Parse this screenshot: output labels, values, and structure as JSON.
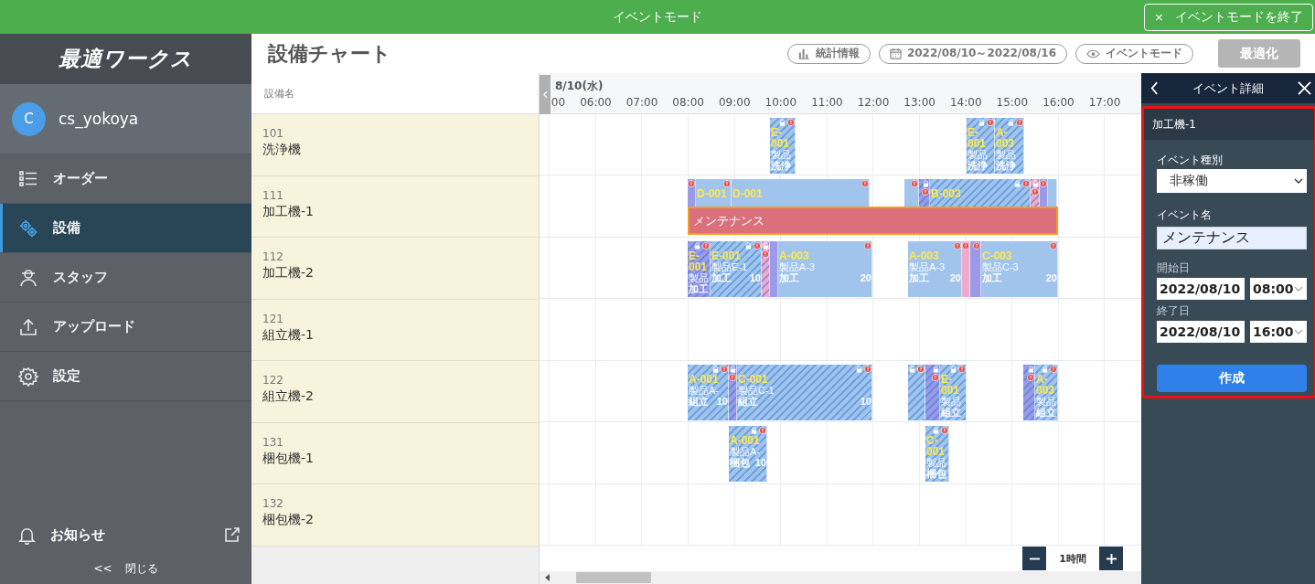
{
  "banner": {
    "title": "イベントモード",
    "exit_icon": "×",
    "exit_label": "イベントモードを終了"
  },
  "sidebar": {
    "logo": "最適ワークス",
    "user": {
      "initial": "C",
      "name": "cs_yokoya"
    },
    "items": [
      {
        "label": "オーダー",
        "selected": false
      },
      {
        "label": "設備",
        "selected": true
      },
      {
        "label": "スタッフ",
        "selected": false
      },
      {
        "label": "アップロード",
        "selected": false
      },
      {
        "label": "設定",
        "selected": false
      }
    ],
    "notice": "お知らせ",
    "collapse_icon": "<<",
    "collapse_label": "閉じる"
  },
  "header": {
    "title": "設備チャート",
    "buttons": [
      "統計情報",
      "2022/08/10～2022/08/16",
      "イベントモード"
    ],
    "optimize": {
      "label": "最適化",
      "disabled": true
    }
  },
  "equipment_heading": "設備名",
  "timeline": {
    "date": "8/10(水)",
    "hours": [
      "00",
      "06:00",
      "07:00",
      "08:00",
      "09:00",
      "10:00",
      "11:00",
      "12:00",
      "13:00",
      "14:00",
      "15:00",
      "16:00",
      "17:00"
    ]
  },
  "rows": [
    {
      "code": "101",
      "name": "洗浄機",
      "blocks": [
        {
          "color": "#a0c4ec",
          "hatched": true,
          "locked": true,
          "warning": true,
          "code": "E-001",
          "product": "製品",
          "process": "洗浄"
        },
        {
          "color": "#a0c4ec",
          "hatched": true,
          "locked": true,
          "warning": true,
          "code": "E-001",
          "product": "製品",
          "process": "洗浄"
        },
        {
          "color": "#a0c4ec",
          "hatched": true,
          "locked": true,
          "warning": true,
          "code": "A-003",
          "product": "製品",
          "process": "洗浄"
        }
      ]
    },
    {
      "code": "111",
      "name": "加工機-1",
      "blocks": [
        {
          "color": "#9a9ae8",
          "hatched": false,
          "locked": false,
          "warning": true
        },
        {
          "color": "#a0c4ec",
          "hatched": false,
          "locked": false,
          "warning": true,
          "code": "D-001"
        },
        {
          "color": "#a0c4ec",
          "hatched": false,
          "locked": false,
          "warning": true,
          "code": "D-001"
        },
        {
          "color": "#a0c4ec",
          "hatched": false,
          "locked": false,
          "warning": true
        },
        {
          "color": "#9a9ae8",
          "hatched": true,
          "locked": true,
          "warning": true
        },
        {
          "color": "#a0c4ec",
          "hatched": true,
          "locked": true,
          "warning": true,
          "code": "B-003"
        },
        {
          "color": "#f0aacd",
          "hatched": true,
          "locked": true,
          "warning": true
        },
        {
          "color": "#9a9ae8",
          "hatched": false,
          "locked": false,
          "warning": true
        },
        {
          "color": "#a0c4ec",
          "hatched": false,
          "locked": false,
          "warning": false
        }
      ],
      "events": [
        {
          "label": "メンテナンス"
        }
      ]
    },
    {
      "code": "112",
      "name": "加工機-2",
      "blocks": [
        {
          "color": "#9a9ae8",
          "hatched": true,
          "locked": true,
          "warning": true,
          "code": "E-001",
          "product": "製品",
          "process": "加工"
        },
        {
          "color": "#a0c4ec",
          "hatched": true,
          "locked": true,
          "warning": true,
          "code": "E-001",
          "product": "製品E-1",
          "process": "加工",
          "qty": "10"
        },
        {
          "color": "#f0aacd",
          "hatched": true,
          "locked": true,
          "warning": true
        },
        {
          "color": "#9a9ae8",
          "hatched": false,
          "locked": false,
          "warning": false
        },
        {
          "color": "#a0c4ec",
          "hatched": false,
          "locked": false,
          "warning": true,
          "code": "A-003",
          "product": "製品A-3",
          "process": "加工",
          "qty": "20"
        },
        {
          "color": "#a0c4ec",
          "hatched": false,
          "locked": false,
          "warning": true,
          "code": "A-003",
          "product": "製品A-3",
          "process": "加工",
          "qty": "20"
        },
        {
          "color": "#f0aacd",
          "hatched": false,
          "locked": false,
          "warning": true
        },
        {
          "color": "#9a9ae8",
          "hatched": false,
          "locked": false,
          "warning": true
        },
        {
          "color": "#a0c4ec",
          "hatched": false,
          "locked": false,
          "warning": true,
          "code": "C-003",
          "product": "製品C-3",
          "process": "加工",
          "qty": "20"
        }
      ]
    },
    {
      "code": "121",
      "name": "組立機-1",
      "blocks": []
    },
    {
      "code": "122",
      "name": "組立機-2",
      "blocks": [
        {
          "color": "#a0c4ec",
          "hatched": true,
          "locked": true,
          "warning": true,
          "code": "A-001",
          "product": "製品A-",
          "process": "組立",
          "qty": "10"
        },
        {
          "color": "#9a9ae8",
          "hatched": true,
          "locked": true,
          "warning": true
        },
        {
          "color": "#a0c4ec",
          "hatched": true,
          "locked": true,
          "warning": true,
          "code": "C-001",
          "product": "製品C-1",
          "process": "組立",
          "qty": "10"
        },
        {
          "color": "#a0c4ec",
          "hatched": true,
          "locked": true,
          "warning": true
        },
        {
          "color": "#9a9ae8",
          "hatched": true,
          "locked": true,
          "warning": true
        },
        {
          "color": "#a0c4ec",
          "hatched": true,
          "locked": true,
          "warning": true,
          "code": "E-001",
          "product": "製品",
          "process": "組立"
        },
        {
          "color": "#9a9ae8",
          "hatched": true,
          "locked": true,
          "warning": true
        },
        {
          "color": "#a0c4ec",
          "hatched": true,
          "locked": true,
          "warning": true,
          "code": "A-003",
          "product": "製品",
          "process": "組立"
        }
      ]
    },
    {
      "code": "131",
      "name": "梱包機-1",
      "blocks": [
        {
          "color": "#a0c4ec",
          "hatched": true,
          "locked": true,
          "warning": true,
          "code": "A-001",
          "product": "製品A-",
          "process": "梱包",
          "qty": "10"
        },
        {
          "color": "#a0c4ec",
          "hatched": true,
          "locked": true,
          "warning": true,
          "code": "C-001",
          "product": "製品",
          "process": "梱包"
        }
      ]
    },
    {
      "code": "132",
      "name": "梱包機-2",
      "blocks": []
    }
  ],
  "zoom_label": "1時間",
  "panel": {
    "title": "イベント詳細",
    "target": "加工機-1",
    "type_label": "イベント種別",
    "type_value": "非稼働",
    "name_label": "イベント名",
    "name_value": "メンテナンス",
    "start_label": "開始日",
    "start_date": "2022/08/10",
    "start_time": "08:00",
    "end_label": "終了日",
    "end_date": "2022/08/10",
    "end_time": "16:00",
    "submit": "作成"
  }
}
